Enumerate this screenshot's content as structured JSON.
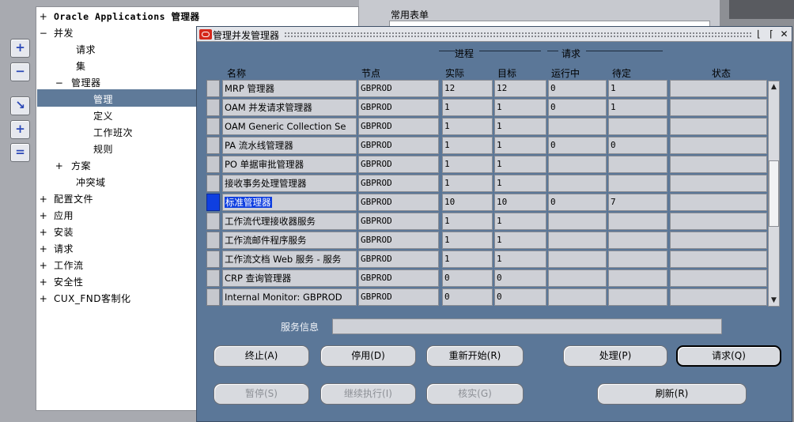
{
  "toolbar": {
    "buttons": [
      {
        "icon": "expand-icon",
        "glyph": "+"
      },
      {
        "icon": "collapse-icon",
        "glyph": "−"
      },
      {
        "icon": "expand-branch-icon",
        "glyph": "↘"
      },
      {
        "icon": "expand-all-icon",
        "glyph": "+"
      },
      {
        "icon": "collapse-all-icon",
        "glyph": "="
      }
    ]
  },
  "tree": {
    "items": [
      {
        "sign": "+",
        "label": "Oracle Applications 管理器"
      },
      {
        "sign": "−",
        "label": "并发"
      },
      {
        "sign": "",
        "label": "请求"
      },
      {
        "sign": "",
        "label": "集"
      },
      {
        "sign": "−",
        "label": "管理器"
      },
      {
        "sign": "",
        "label": "管理"
      },
      {
        "sign": "",
        "label": "定义"
      },
      {
        "sign": "",
        "label": "工作班次"
      },
      {
        "sign": "",
        "label": "规则"
      },
      {
        "sign": "+",
        "label": "方案"
      },
      {
        "sign": "",
        "label": "冲突域"
      },
      {
        "sign": "+",
        "label": "配置文件"
      },
      {
        "sign": "+",
        "label": "应用"
      },
      {
        "sign": "+",
        "label": "安装"
      },
      {
        "sign": "+",
        "label": "请求"
      },
      {
        "sign": "+",
        "label": "工作流"
      },
      {
        "sign": "+",
        "label": "安全性"
      },
      {
        "sign": "+",
        "label": "CUX_FND客制化"
      }
    ]
  },
  "common_forms": {
    "label": "常用表单"
  },
  "dialog": {
    "title": "管理并发管理器",
    "controls": {
      "minimize": "⌊",
      "maximize": "⌈",
      "close": "✕"
    },
    "groups": {
      "process": "进程",
      "request": "请求"
    },
    "columns": {
      "name": "名称",
      "node": "节点",
      "actual": "实际",
      "target": "目标",
      "running": "运行中",
      "pending": "待定",
      "status": "状态"
    },
    "rows": [
      {
        "name": "MRP 管理器",
        "node": "GBPROD",
        "actual": "12",
        "target": "12",
        "running": "0",
        "pending": "1",
        "status": ""
      },
      {
        "name": "OAM 并发请求管理器",
        "node": "GBPROD",
        "actual": "1",
        "target": "1",
        "running": "0",
        "pending": "1",
        "status": ""
      },
      {
        "name": "OAM Generic Collection Se",
        "node": "GBPROD",
        "actual": "1",
        "target": "1",
        "running": "",
        "pending": "",
        "status": ""
      },
      {
        "name": "PA 流水线管理器",
        "node": "GBPROD",
        "actual": "1",
        "target": "1",
        "running": "0",
        "pending": "0",
        "status": ""
      },
      {
        "name": "PO 单据审批管理器",
        "node": "GBPROD",
        "actual": "1",
        "target": "1",
        "running": "",
        "pending": "",
        "status": ""
      },
      {
        "name": "接收事务处理管理器",
        "node": "GBPROD",
        "actual": "1",
        "target": "1",
        "running": "",
        "pending": "",
        "status": ""
      },
      {
        "name": "标准管理器",
        "node": "GBPROD",
        "actual": "10",
        "target": "10",
        "running": "0",
        "pending": "7",
        "status": ""
      },
      {
        "name": "工作流代理接收器服务",
        "node": "GBPROD",
        "actual": "1",
        "target": "1",
        "running": "",
        "pending": "",
        "status": ""
      },
      {
        "name": "工作流邮件程序服务",
        "node": "GBPROD",
        "actual": "1",
        "target": "1",
        "running": "",
        "pending": "",
        "status": ""
      },
      {
        "name": "工作流文档 Web 服务 - 服务",
        "node": "GBPROD",
        "actual": "1",
        "target": "1",
        "running": "",
        "pending": "",
        "status": ""
      },
      {
        "name": "CRP 查询管理器",
        "node": "GBPROD",
        "actual": "0",
        "target": "0",
        "running": "",
        "pending": "",
        "status": ""
      },
      {
        "name": "Internal Monitor: GBPROD",
        "node": "GBPROD",
        "actual": "0",
        "target": "0",
        "running": "",
        "pending": "",
        "status": ""
      }
    ],
    "selected_row": 6,
    "service_info": {
      "label": "服务信息",
      "value": ""
    },
    "buttons": {
      "terminate": "终止(A)",
      "deactivate": "停用(D)",
      "restart": "重新开始(R)",
      "process": "处理(P)",
      "request": "请求(Q)",
      "suspend": "暂停(S)",
      "resume": "继续执行(I)",
      "verify": "核实(G)",
      "refresh": "刷新(R)"
    }
  },
  "colors": {
    "window_bg": "#5b7798",
    "selection": "#0f3fe0",
    "tree_selection": "#5f7a99"
  }
}
